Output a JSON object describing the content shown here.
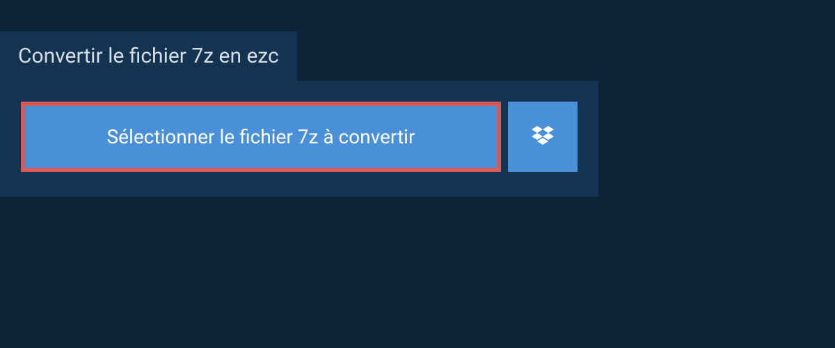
{
  "tab": {
    "title": "Convertir le fichier 7z en ezc"
  },
  "actions": {
    "select_file_label": "Sélectionner le fichier 7z à convertir"
  }
}
